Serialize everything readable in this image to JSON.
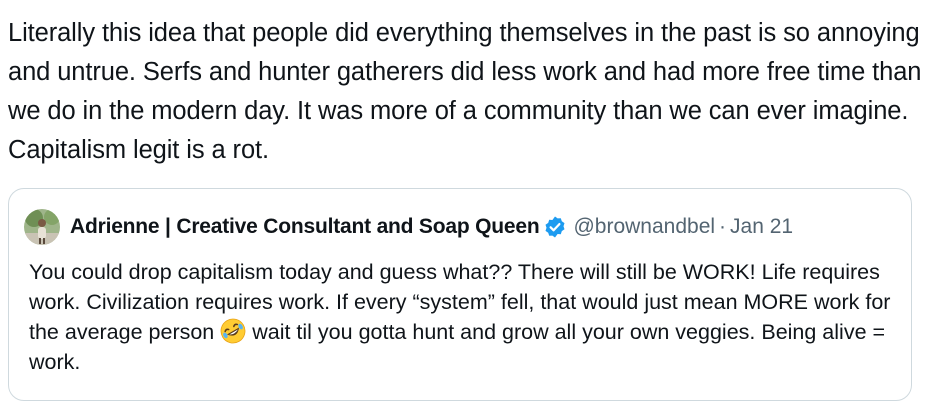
{
  "tweet": {
    "text": "Literally this idea that people did everything themselves in the past is so annoying and untrue. Serfs and hunter gatherers did less work and had more free time than we do in the modern day. It was more of a community than we can ever imagine. Capitalism legit is a rot."
  },
  "quoted_tweet": {
    "author_name": "Adrienne | Creative Consultant and Soap Queen",
    "handle": "@brownandbel",
    "separator": "·",
    "date": "Jan 21",
    "text_before_emoji": "You could drop capitalism today and guess what?? There will still be WORK! Life requires work. Civilization requires work. If every “system” fell, that would just mean MORE work for the average person ",
    "emoji": "rolling-on-floor-laughing-emoji",
    "text_after_emoji": " wait til you gotta hunt and grow all your own veggies. Being alive = work.",
    "verified_color": "#1d9bf0"
  }
}
